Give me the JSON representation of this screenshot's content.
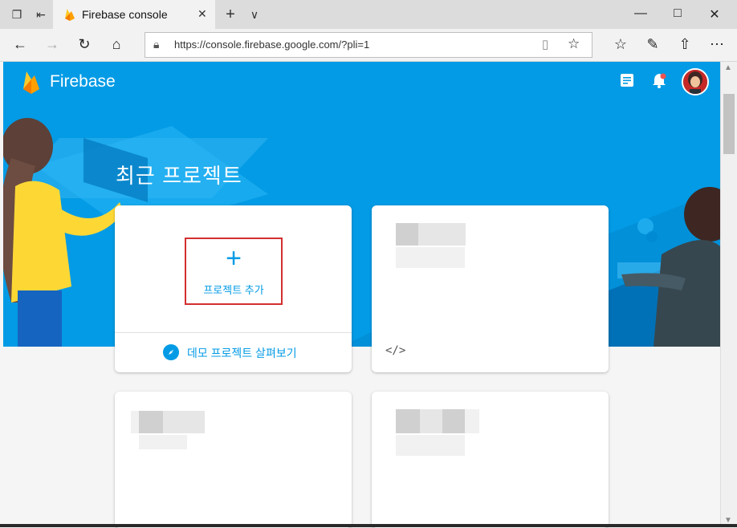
{
  "browser": {
    "tab_title": "Firebase console",
    "url": "https://console.firebase.google.com/?pli=1"
  },
  "header": {
    "app_name": "Firebase"
  },
  "main": {
    "section_title": "최근 프로젝트",
    "add_project_label": "프로젝트 추가",
    "demo_link_label": "데모 프로젝트 살펴보기",
    "code_icon_text": "</>"
  },
  "colors": {
    "hero_blue": "#039be5",
    "highlight_red": "#d32f2f",
    "firebase_yellow": "#ffca28",
    "firebase_orange": "#ffa000"
  },
  "icons": [
    "tab-actions-icon",
    "set-aside-icon",
    "firebase-flame-icon",
    "close-icon",
    "new-tab-icon",
    "tab-list-icon",
    "minimize-icon",
    "maximize-icon",
    "window-close-icon",
    "back-icon",
    "forward-icon",
    "refresh-icon",
    "home-icon",
    "lock-icon",
    "reading-view-icon",
    "favorite-star-icon",
    "favorites-icon",
    "pen-icon",
    "share-icon",
    "more-icon",
    "docs-icon",
    "notifications-bell-icon",
    "plus-icon",
    "compass-icon",
    "code-icon"
  ]
}
